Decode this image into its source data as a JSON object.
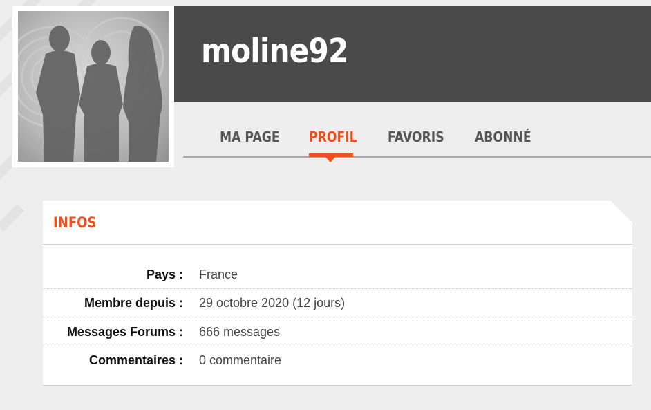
{
  "profile": {
    "username": "moline92"
  },
  "tabs": [
    {
      "label": "MA PAGE",
      "active": false
    },
    {
      "label": "PROFIL",
      "active": true
    },
    {
      "label": "FAVORIS",
      "active": false
    },
    {
      "label": "ABONNÉ",
      "active": false
    }
  ],
  "infos": {
    "title": "INFOS",
    "rows": [
      {
        "label": "Pays :",
        "value": "France"
      },
      {
        "label": "Membre depuis :",
        "value": "29 octobre 2020 (12 jours)"
      },
      {
        "label": "Messages Forums :",
        "value": "666 messages"
      },
      {
        "label": "Commentaires :",
        "value": "0 commentaire"
      }
    ]
  },
  "colors": {
    "accent": "#f04e1a",
    "header_bg": "#4a4a4a",
    "page_bg": "#eeeeee",
    "tab_text": "#555555"
  },
  "icons": {
    "avatar": "silhouettes-avatar"
  }
}
